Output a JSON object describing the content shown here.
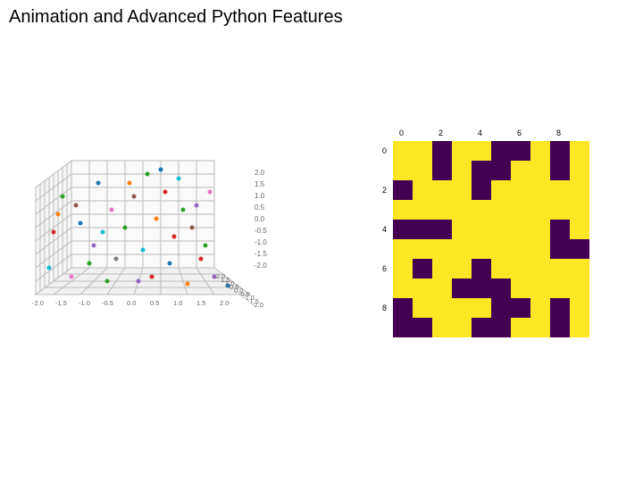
{
  "slide": {
    "title": "Animation and Advanced Python Features"
  },
  "chart_data": [
    {
      "type": "scatter",
      "subtype": "3d-scatter",
      "title": "",
      "x_range": [
        -2.0,
        2.0
      ],
      "y_range": [
        -2.0,
        2.0
      ],
      "z_range": [
        -2.0,
        2.0
      ],
      "x_ticks": [
        -2.0,
        -1.5,
        -1.0,
        -0.5,
        0.0,
        0.5,
        1.0,
        1.5,
        2.0
      ],
      "y_ticks": [
        -2.0,
        -1.5,
        -1.0,
        -0.5,
        0.0,
        0.5,
        1.0,
        1.5,
        2.0
      ],
      "z_ticks": [
        -2.0,
        -1.5,
        -1.0,
        -0.5,
        0.0,
        0.5,
        1.0,
        1.5,
        2.0
      ],
      "z_tick_labels": [
        "2.0",
        "1.5",
        "1.0",
        "0.5",
        "0.0",
        "-0.5",
        "-1.0",
        "-1.5",
        "-2.0"
      ],
      "x_tick_labels": [
        "-2.0",
        "-1.5",
        "-1.0",
        "-0.5",
        "0.0",
        "0.5",
        "1.0",
        "1.5",
        "2.0"
      ],
      "y_tick_labels": [
        "-2.0",
        "-1.5",
        "-1.0",
        "-0.5",
        "0.0",
        "0.5",
        "1.0",
        "1.5",
        "2.0"
      ],
      "points_description": "approximately 40 colored scatter points distributed randomly inside a 3D cube with gridded walls"
    },
    {
      "type": "heatmap",
      "title": "",
      "x_ticks": [
        0,
        2,
        4,
        6,
        8
      ],
      "y_ticks": [
        0,
        2,
        4,
        6,
        8
      ],
      "x_tick_labels": [
        "0",
        "2",
        "4",
        "6",
        "8"
      ],
      "y_tick_labels": [
        "0",
        "2",
        "4",
        "6",
        "8"
      ],
      "colormap": {
        "0": "#440154",
        "1": "#fde725"
      },
      "grid": [
        [
          1,
          1,
          0,
          1,
          1,
          0,
          0,
          1,
          0,
          1
        ],
        [
          1,
          1,
          0,
          1,
          0,
          0,
          1,
          1,
          0,
          1
        ],
        [
          0,
          1,
          1,
          1,
          0,
          1,
          1,
          1,
          1,
          1
        ],
        [
          1,
          1,
          1,
          1,
          1,
          1,
          1,
          1,
          1,
          1
        ],
        [
          0,
          0,
          0,
          1,
          1,
          1,
          1,
          1,
          0,
          1
        ],
        [
          1,
          1,
          1,
          1,
          1,
          1,
          1,
          1,
          0,
          0
        ],
        [
          1,
          0,
          1,
          1,
          0,
          1,
          1,
          1,
          1,
          1
        ],
        [
          1,
          1,
          1,
          0,
          0,
          0,
          1,
          1,
          1,
          1
        ],
        [
          0,
          1,
          1,
          1,
          1,
          0,
          0,
          1,
          0,
          1
        ],
        [
          0,
          0,
          1,
          1,
          0,
          0,
          1,
          1,
          0,
          1
        ]
      ]
    }
  ]
}
